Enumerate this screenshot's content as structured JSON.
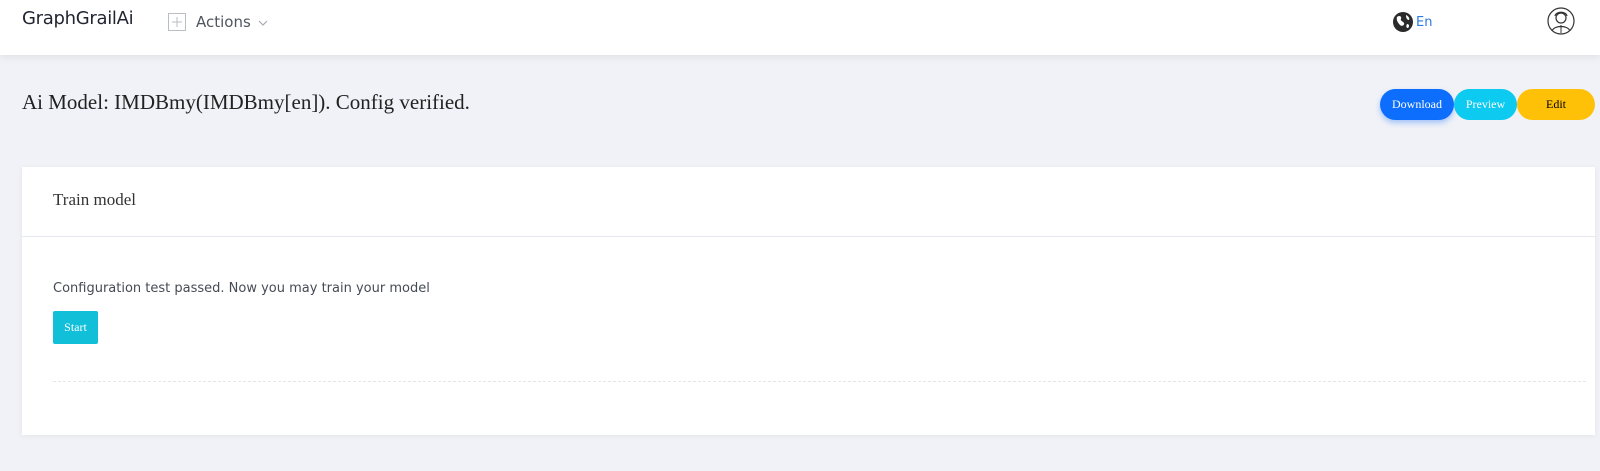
{
  "header": {
    "brand": "GraphGrailAi",
    "actions_label": "Actions",
    "language": "En",
    "icons": {
      "actions": "plus-square-icon",
      "actions_chevron": "chevron-down-icon",
      "language": "globe-icon",
      "avatar": "user-avatar-icon"
    },
    "accent_color": "#2c7be5"
  },
  "page": {
    "title": "Ai Model: IMDBmy(IMDBmy[en]). Config verified."
  },
  "toolbar": {
    "download_label": "Download",
    "preview_label": "Preview",
    "edit_label": "Edit",
    "colors": {
      "download": "#0d6efd",
      "preview": "#0dcaf0",
      "edit": "#ffc107"
    }
  },
  "train_card": {
    "title": "Train model",
    "message": "Configuration test passed. Now you may train your model",
    "start_label": "Start",
    "start_color": "#12bfd9"
  }
}
